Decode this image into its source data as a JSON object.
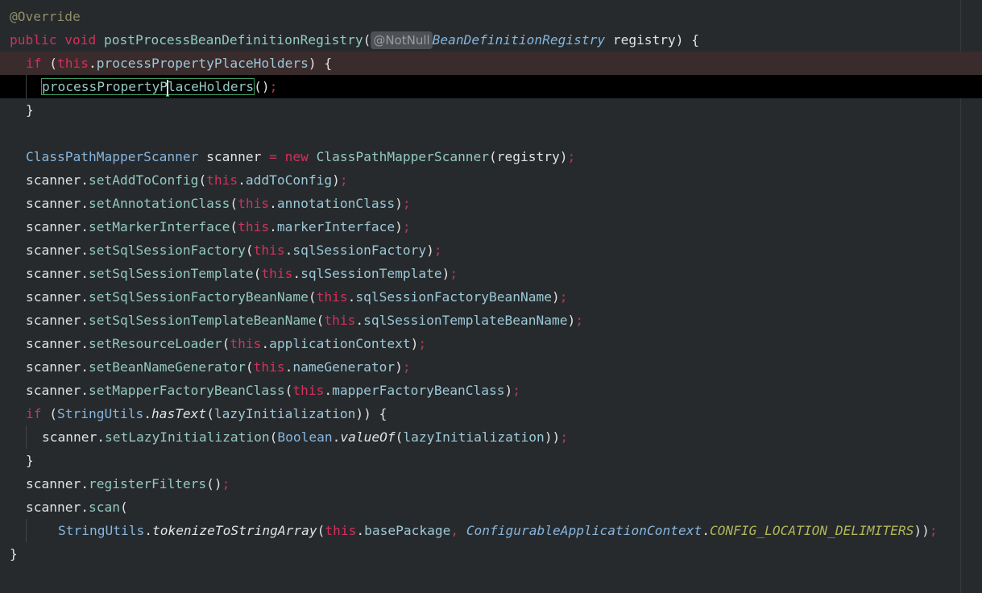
{
  "code": {
    "annotation": "@Override",
    "kw_public": "public",
    "kw_void": "void",
    "kw_if": "if",
    "kw_new": "new",
    "kw_this": "this",
    "method_name": "postProcessBeanDefinitionRegistry",
    "param_hint": "@NotNull",
    "param_type": "BeanDefinitionRegistry",
    "param_name": "registry",
    "field_processPropertyPlaceHolders": "processPropertyPlaceHolders",
    "call_processPropertyPlaceHolders_a": "processPropertyP",
    "call_processPropertyPlaceHolders_b": "laceHolders",
    "scanner_type": "ClassPathMapperScanner",
    "scanner_var": "scanner",
    "setters": [
      {
        "method": "setAddToConfig",
        "field": "addToConfig"
      },
      {
        "method": "setAnnotationClass",
        "field": "annotationClass"
      },
      {
        "method": "setMarkerInterface",
        "field": "markerInterface"
      },
      {
        "method": "setSqlSessionFactory",
        "field": "sqlSessionFactory"
      },
      {
        "method": "setSqlSessionTemplate",
        "field": "sqlSessionTemplate"
      },
      {
        "method": "setSqlSessionFactoryBeanName",
        "field": "sqlSessionFactoryBeanName"
      },
      {
        "method": "setSqlSessionTemplateBeanName",
        "field": "sqlSessionTemplateBeanName"
      },
      {
        "method": "setResourceLoader",
        "field": "applicationContext"
      },
      {
        "method": "setBeanNameGenerator",
        "field": "nameGenerator"
      },
      {
        "method": "setMapperFactoryBeanClass",
        "field": "mapperFactoryBeanClass"
      }
    ],
    "string_utils": "StringUtils",
    "has_text": "hasText",
    "lazy_init": "lazyInitialization",
    "set_lazy_init": "setLazyInitialization",
    "boolean_type": "Boolean",
    "value_of": "valueOf",
    "register_filters": "registerFilters",
    "scan": "scan",
    "tokenize": "tokenizeToStringArray",
    "base_package": "basePackage",
    "cac_type": "ConfigurableApplicationContext",
    "cac_const": "CONFIG_LOCATION_DELIMITERS"
  },
  "colors": {
    "background": "#262a2d",
    "keyword": "#d3305b",
    "method": "#94c9c0",
    "type": "#87b5dd",
    "annotation": "#8f8e66",
    "constant": "#b2b657",
    "current_line": "#000000",
    "breakpoint_line": "#3a2b2d",
    "match_box": "#3e9a62"
  }
}
